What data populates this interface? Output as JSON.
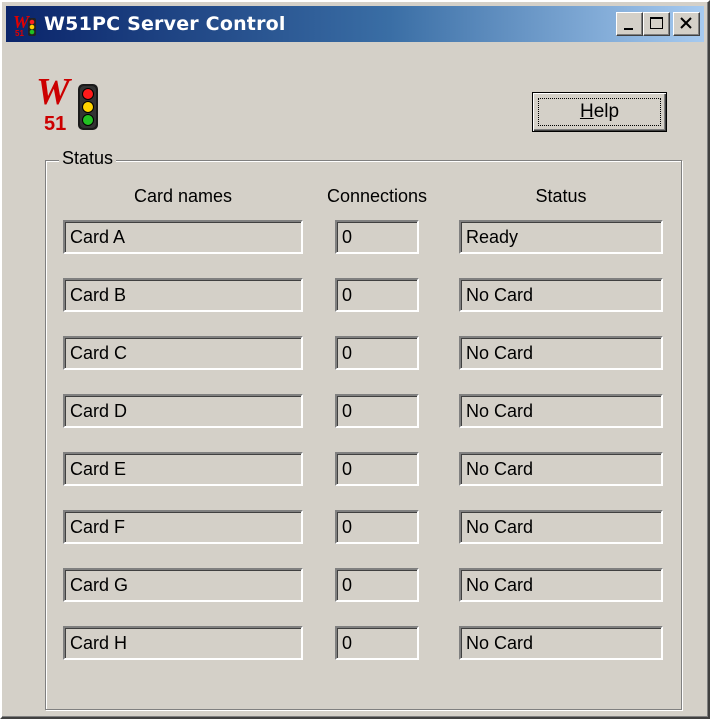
{
  "window": {
    "title": "W51PC Server Control"
  },
  "logo": {
    "letter": "W",
    "number": "51",
    "icon": "traffic-light-icon"
  },
  "help_button": {
    "mnemonic": "H",
    "rest": "elp"
  },
  "status_group": {
    "label": "Status",
    "headers": {
      "card_names": "Card names",
      "connections": "Connections",
      "status": "Status"
    },
    "rows": [
      {
        "name": "Card A",
        "connections": "0",
        "status": "Ready"
      },
      {
        "name": "Card B",
        "connections": "0",
        "status": "No Card"
      },
      {
        "name": "Card C",
        "connections": "0",
        "status": "No Card"
      },
      {
        "name": "Card D",
        "connections": "0",
        "status": "No Card"
      },
      {
        "name": "Card E",
        "connections": "0",
        "status": "No Card"
      },
      {
        "name": "Card F",
        "connections": "0",
        "status": "No Card"
      },
      {
        "name": "Card G",
        "connections": "0",
        "status": "No Card"
      },
      {
        "name": "Card H",
        "connections": "0",
        "status": "No Card"
      }
    ]
  },
  "colors": {
    "face": "#d4d0c8",
    "title_start": "#0a246a",
    "title_end": "#a6caf0",
    "logo_red": "#cc0000"
  }
}
